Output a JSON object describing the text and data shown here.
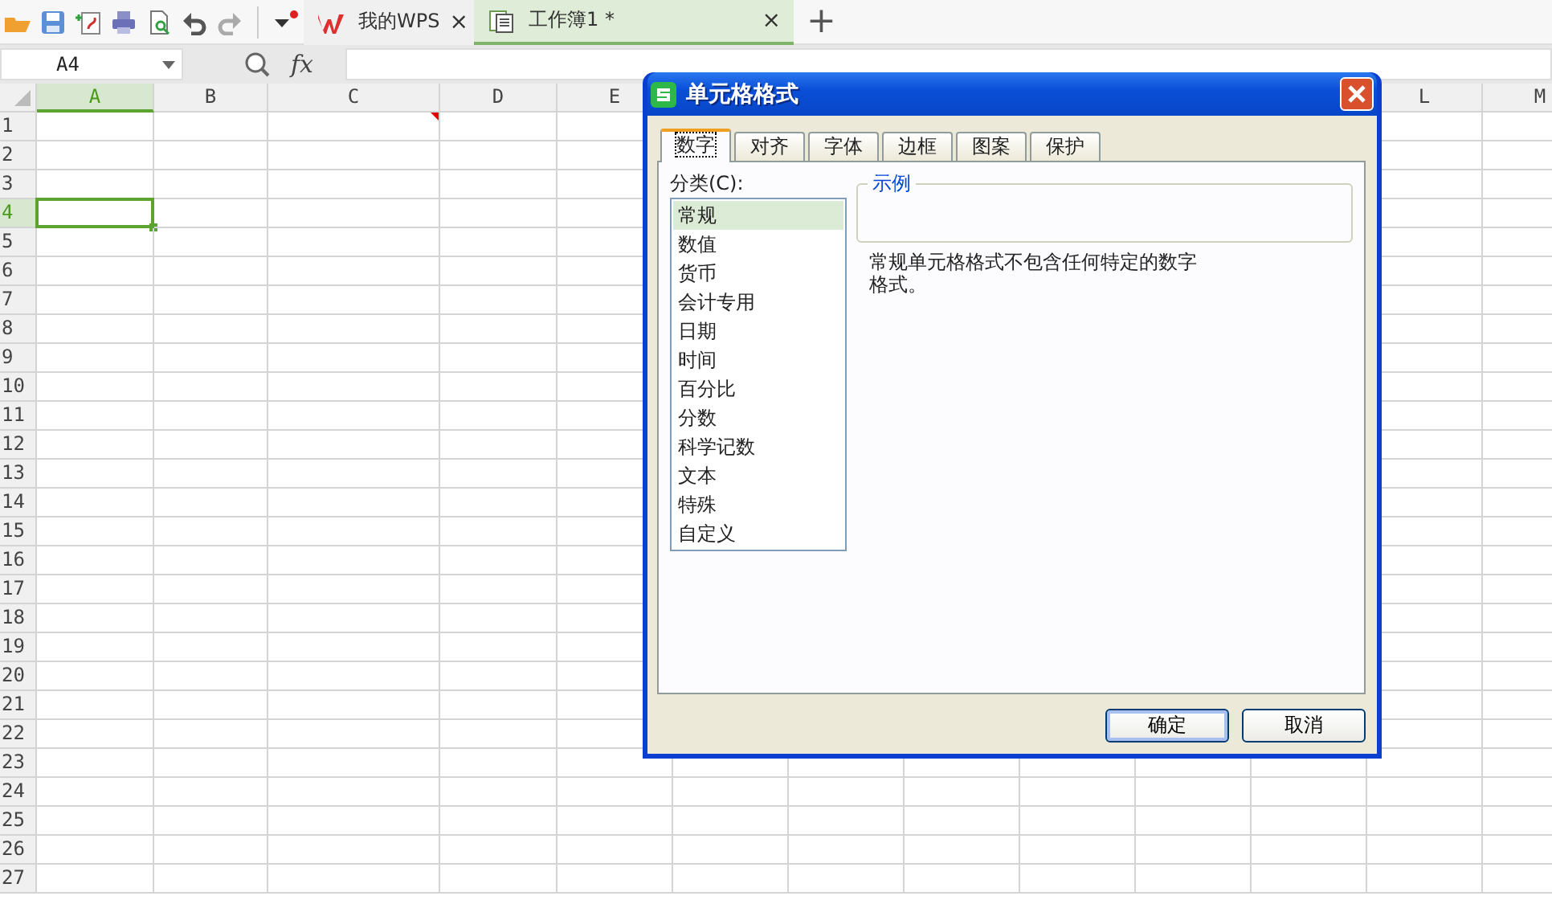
{
  "toolbar": {
    "tabs": [
      {
        "label": "我的WPS",
        "selected": false,
        "kind": "home",
        "close": "×"
      },
      {
        "label": "工作簿1 *",
        "selected": true,
        "kind": "book",
        "close": "×"
      }
    ],
    "new_tab": "+"
  },
  "formula_bar": {
    "name_box": "A4",
    "fx": "fx"
  },
  "sheet": {
    "columns": [
      {
        "label": "A",
        "selected": true,
        "comment": false
      },
      {
        "label": "B",
        "selected": false,
        "comment": false
      },
      {
        "label": "C",
        "selected": false,
        "comment": true
      },
      {
        "label": "D",
        "selected": false,
        "comment": false
      },
      {
        "label": "E",
        "selected": false,
        "comment": false
      },
      {
        "label": "L",
        "selected": false,
        "comment": false
      },
      {
        "label": "M",
        "selected": false,
        "comment": false
      }
    ],
    "rows": [
      {
        "label": "1",
        "selected": false,
        "comment": true
      },
      {
        "label": "2",
        "selected": false,
        "comment": false
      },
      {
        "label": "3",
        "selected": false,
        "comment": false
      },
      {
        "label": "4",
        "selected": true,
        "comment": false
      },
      {
        "label": "5",
        "selected": false,
        "comment": false
      },
      {
        "label": "6",
        "selected": false,
        "comment": false
      },
      {
        "label": "7",
        "selected": false,
        "comment": false
      },
      {
        "label": "8",
        "selected": false,
        "comment": false
      },
      {
        "label": "9",
        "selected": false,
        "comment": false
      },
      {
        "label": "10",
        "selected": false,
        "comment": false
      },
      {
        "label": "11",
        "selected": false,
        "comment": false
      },
      {
        "label": "12",
        "selected": false,
        "comment": false
      },
      {
        "label": "13",
        "selected": false,
        "comment": false
      },
      {
        "label": "14",
        "selected": false,
        "comment": false
      },
      {
        "label": "15",
        "selected": false,
        "comment": false
      },
      {
        "label": "16",
        "selected": false,
        "comment": false
      },
      {
        "label": "17",
        "selected": false,
        "comment": false
      },
      {
        "label": "18",
        "selected": false,
        "comment": false
      },
      {
        "label": "19",
        "selected": false,
        "comment": false
      },
      {
        "label": "20",
        "selected": false,
        "comment": false
      },
      {
        "label": "21",
        "selected": false,
        "comment": false
      },
      {
        "label": "22",
        "selected": false,
        "comment": false
      },
      {
        "label": "23",
        "selected": false,
        "comment": false
      },
      {
        "label": "24",
        "selected": false,
        "comment": false
      },
      {
        "label": "25",
        "selected": false,
        "comment": false
      },
      {
        "label": "26",
        "selected": false,
        "comment": false
      },
      {
        "label": "27",
        "selected": false,
        "comment": false
      }
    ]
  },
  "dialog": {
    "title": "单元格格式",
    "tabs": [
      {
        "label": "数字",
        "selected": true
      },
      {
        "label": "对齐",
        "selected": false
      },
      {
        "label": "字体",
        "selected": false
      },
      {
        "label": "边框",
        "selected": false
      },
      {
        "label": "图案",
        "selected": false
      },
      {
        "label": "保护",
        "selected": false
      }
    ],
    "category_label": "分类(C):",
    "categories": [
      {
        "label": "常规",
        "selected": true
      },
      {
        "label": "数值",
        "selected": false
      },
      {
        "label": "货币",
        "selected": false
      },
      {
        "label": "会计专用",
        "selected": false
      },
      {
        "label": "日期",
        "selected": false
      },
      {
        "label": "时间",
        "selected": false
      },
      {
        "label": "百分比",
        "selected": false
      },
      {
        "label": "分数",
        "selected": false
      },
      {
        "label": "科学记数",
        "selected": false
      },
      {
        "label": "文本",
        "selected": false
      },
      {
        "label": "特殊",
        "selected": false
      },
      {
        "label": "自定义",
        "selected": false
      }
    ],
    "sample_label": "示例",
    "description": "常规单元格格式不包含任何特定的数字格式。",
    "buttons": [
      {
        "label": "确定",
        "kind": "default"
      },
      {
        "label": "取消",
        "kind": "normal"
      }
    ]
  }
}
